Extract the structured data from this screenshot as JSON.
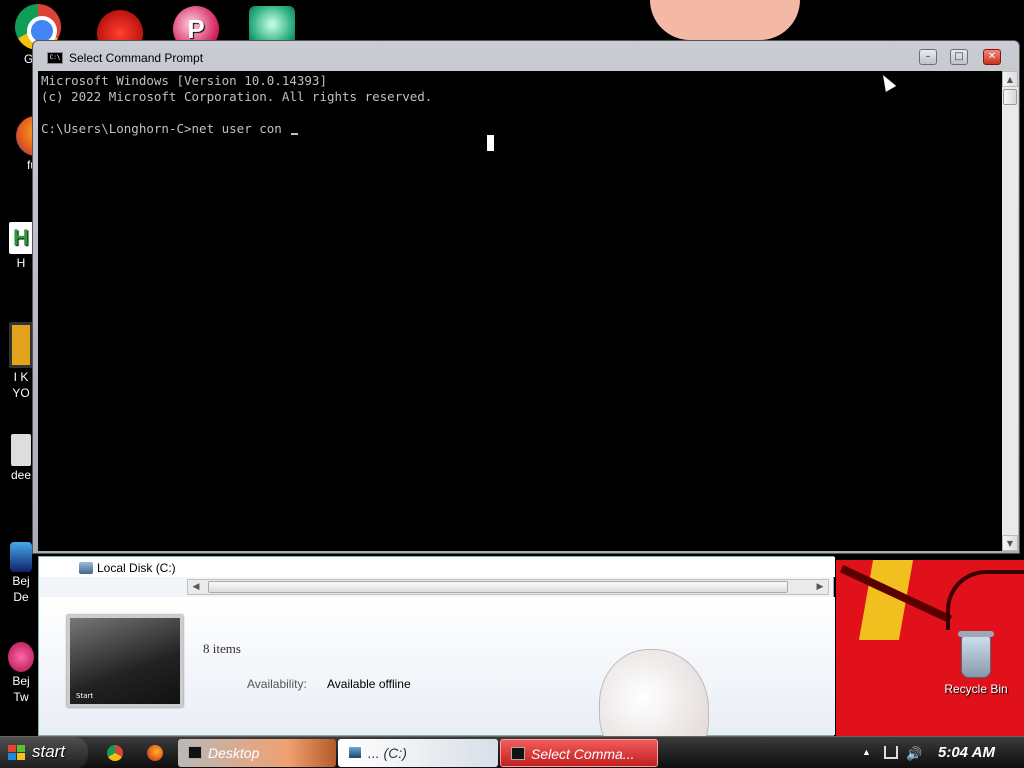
{
  "desktop": {
    "icons": [
      {
        "label": "GOO"
      },
      {
        "label": ""
      },
      {
        "label": ""
      },
      {
        "label": ""
      },
      {
        "label": "furr"
      },
      {
        "label": "H"
      },
      {
        "label": "I K"
      },
      {
        "label": "YO"
      },
      {
        "label": "dee"
      },
      {
        "label": "Bej"
      },
      {
        "label": "De"
      },
      {
        "label": "Bej"
      },
      {
        "label": "Tw"
      }
    ],
    "recycle_bin_label": "Recycle Bin"
  },
  "cmd_window": {
    "title": "Select Command Prompt",
    "icon_text": "C:\\",
    "lines": [
      "Microsoft Windows [Version 10.0.14393]",
      "(c) 2022 Microsoft Corporation. All rights reserved.",
      "",
      "C:\\Users\\Longhorn-C>net user con "
    ],
    "buttons": {
      "minimize": "–",
      "maximize": "□",
      "close": "✕"
    },
    "scroll_up": "▲",
    "scroll_down": "▼"
  },
  "explorer_window": {
    "nav_item": "Local Disk (C:)",
    "item_count": "8 items",
    "availability_label": "Availability:",
    "availability_value": "Available offline",
    "thumbnail_start": "Start",
    "scroll_left": "◀",
    "scroll_right": "▶"
  },
  "taskbar": {
    "start_label": "start",
    "items": [
      {
        "label": "Desktop"
      },
      {
        "label": "... (C:)"
      },
      {
        "label": "Select Comma..."
      }
    ],
    "tray": {
      "caret": "▲",
      "volume": "🔊",
      "time": "5:04 AM"
    }
  }
}
